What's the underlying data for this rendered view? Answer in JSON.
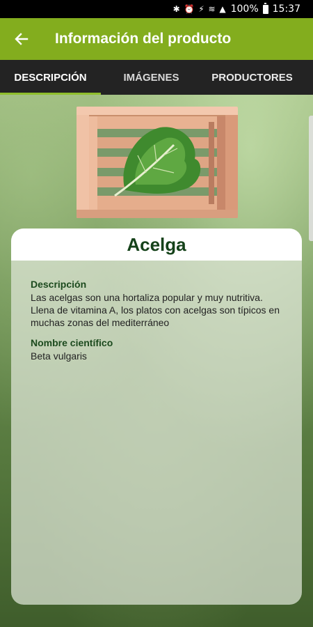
{
  "status_bar": {
    "icons": "✱ ⏰ ⚡ ≋ ▲",
    "battery": "100%",
    "time": "15:37"
  },
  "app_bar": {
    "title": "Información del producto"
  },
  "tabs": [
    {
      "label": "DESCRIPCIÓN",
      "active": true
    },
    {
      "label": "IMÁGENES",
      "active": false
    },
    {
      "label": "PRODUCTORES",
      "active": false
    }
  ],
  "product": {
    "name": "Acelga",
    "fields": [
      {
        "label": "Descripción",
        "value": "Las acelgas son una hortaliza popular y muy nutritiva. Llena de vitamina A, los platos con acelgas son típicos en muchas zonas del mediterráneo"
      },
      {
        "label": "Nombre científico",
        "value": "Beta vulgaris"
      }
    ]
  },
  "colors": {
    "app_bar": "#83ad1e",
    "tab_bar": "#232323",
    "tab_indicator": "#8fbf2c",
    "title_text": "#15421a"
  }
}
